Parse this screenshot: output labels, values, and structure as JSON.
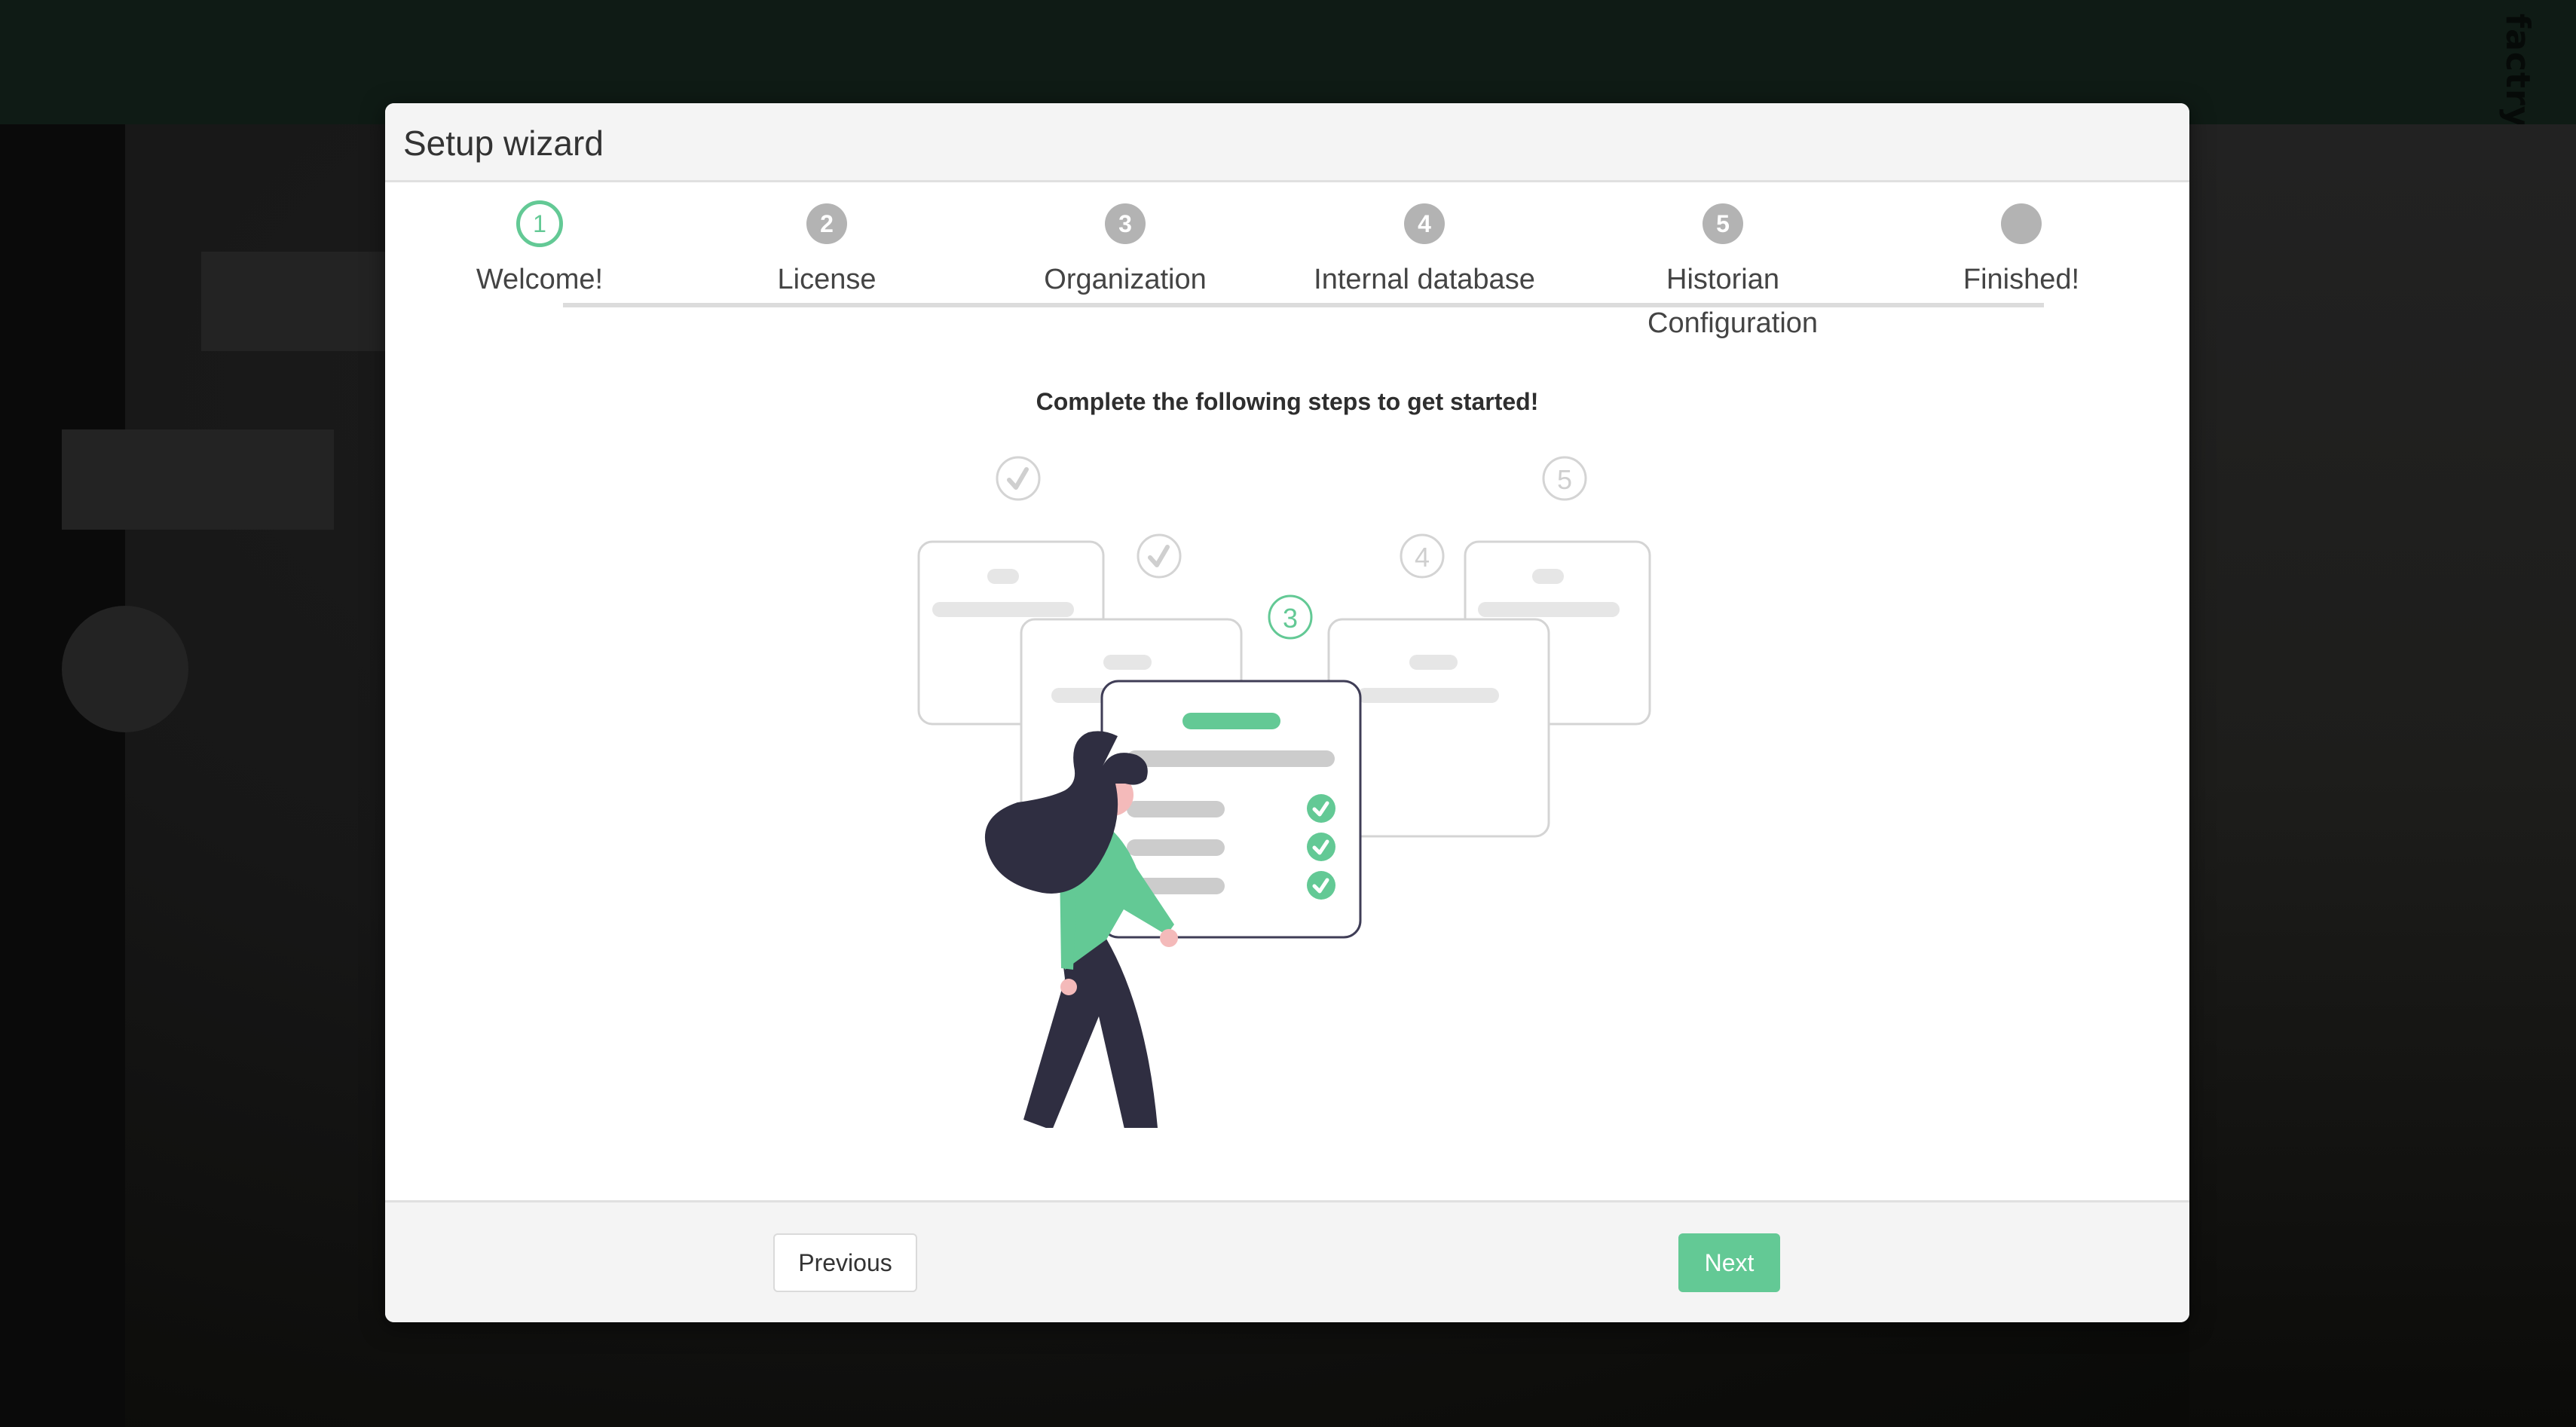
{
  "app": {
    "brand": "factry"
  },
  "modal": {
    "title": "Setup wizard",
    "subtitle": "Complete the following steps to get started!",
    "steps": [
      {
        "number": "1",
        "label": "Welcome!",
        "state": "active"
      },
      {
        "number": "2",
        "label": "License",
        "state": "pending"
      },
      {
        "number": "3",
        "label": "Organization",
        "state": "pending"
      },
      {
        "number": "4",
        "label": "Internal database",
        "state": "pending"
      },
      {
        "number": "5",
        "label": "Historian Configuration",
        "state": "pending"
      },
      {
        "number": "",
        "label": "Finished!",
        "state": "pending"
      }
    ],
    "illustration": {
      "badges": [
        "✓",
        "✓",
        "3",
        "4",
        "5"
      ]
    },
    "footer": {
      "previous_label": "Previous",
      "next_label": "Next"
    }
  },
  "colors": {
    "accent": "#63c995",
    "step_inactive": "#b3b3b3",
    "topbar": "#0f1b15",
    "figure_dark": "#2f2e41",
    "skin": "#f4baba"
  }
}
